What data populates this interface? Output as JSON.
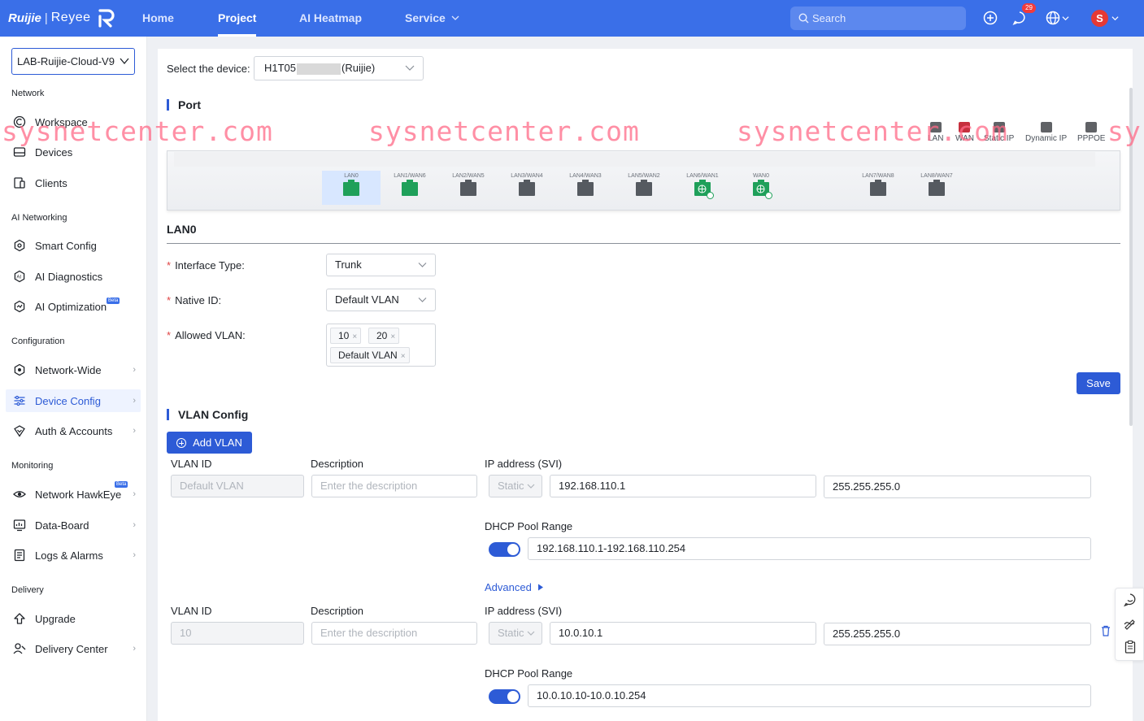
{
  "brand": {
    "name": "Ruijie",
    "sub": "Reyee"
  },
  "nav": {
    "home": "Home",
    "project": "Project",
    "ai_heatmap": "AI Heatmap",
    "service": "Service"
  },
  "search": {
    "placeholder": "Search"
  },
  "notifications": {
    "count": "29"
  },
  "user": {
    "initial": "S"
  },
  "sidebar": {
    "project": "LAB-Ruijie-Cloud-V9",
    "sections": {
      "network": "Network",
      "ai_networking": "AI Networking",
      "configuration": "Configuration",
      "monitoring": "Monitoring",
      "delivery": "Delivery"
    },
    "items": {
      "workspace": "Workspace",
      "devices": "Devices",
      "clients": "Clients",
      "smart_config": "Smart Config",
      "ai_diagnostics": "AI Diagnostics",
      "ai_optimization": "AI Optimization",
      "network_wide": "Network-Wide",
      "device_config": "Device Config",
      "auth_accounts": "Auth & Accounts",
      "network_hawkeye": "Network HawkEye",
      "data_board": "Data-Board",
      "logs_alarms": "Logs & Alarms",
      "upgrade": "Upgrade",
      "delivery_center": "Delivery Center"
    },
    "beta": "Beta"
  },
  "device": {
    "label": "Select the device:",
    "prefix": "H1T05",
    "suffix": "(Ruijie)"
  },
  "port_section": {
    "title": "Port",
    "legend": [
      "LAN",
      "WAN",
      "Static IP",
      "Dynamic IP",
      "PPPOE"
    ],
    "ports": [
      "LAN0",
      "LAN1/WAN6",
      "LAN2/WAN5",
      "LAN3/WAN4",
      "LAN4/WAN3",
      "LAN5/WAN2",
      "LAN6/WAN1",
      "WAN0",
      "LAN7/WAN8",
      "LAN8/WAN7"
    ]
  },
  "lan0": {
    "title": "LAN0",
    "interface_type_label": "Interface Type:",
    "interface_type": "Trunk",
    "native_id_label": "Native ID:",
    "native_id": "Default VLAN",
    "allowed_vlan_label": "Allowed VLAN:",
    "allowed_vlans": [
      "10",
      "20",
      "Default VLAN"
    ],
    "save": "Save"
  },
  "vlan_config": {
    "title": "VLAN Config",
    "add": "Add VLAN",
    "col_vlan_id": "VLAN ID",
    "col_description": "Description",
    "col_ip": "IP address (SVI)",
    "dhcp_label": "DHCP Pool Range",
    "desc_placeholder": "Enter the description",
    "advanced": "Advanced",
    "rows": [
      {
        "vlan_id": "Default VLAN",
        "mode": "Static",
        "ip": "192.168.110.1",
        "mask": "255.255.255.0",
        "dhcp": "192.168.110.1-192.168.110.254"
      },
      {
        "vlan_id": "10",
        "mode": "Static",
        "ip": "10.0.10.1",
        "mask": "255.255.255.0",
        "dhcp": "10.0.10.10-10.0.10.254"
      }
    ]
  },
  "watermark": "sysnetcenter.com",
  "watermark_partial": "sy"
}
